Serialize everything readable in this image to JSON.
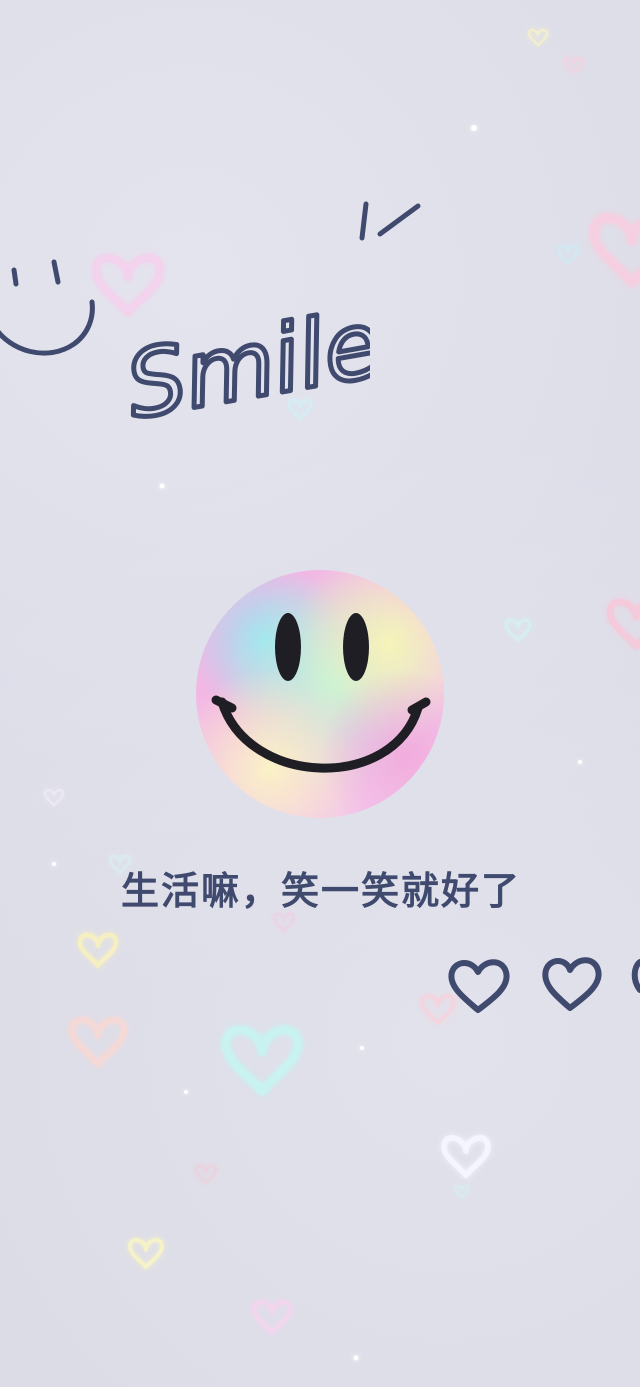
{
  "wallpaper": {
    "handwritten_text": "Smile",
    "caption": "生活嘛，笑一笑就好了"
  },
  "colors": {
    "background": "#dcdce8",
    "ink": "#3f4a6e",
    "smiley_ink": "#1e1e24"
  },
  "decorations": {
    "icons": [
      "doodle-smiley-icon",
      "rainbow-smiley-face-icon",
      "heart-icon",
      "sparkle-icon"
    ]
  }
}
